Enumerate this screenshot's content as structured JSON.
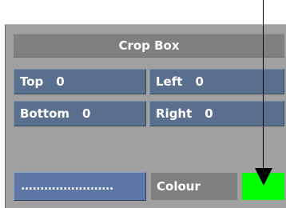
{
  "crop_box": {
    "title": "Crop Box",
    "top": {
      "label": "Top",
      "value": "0"
    },
    "left": {
      "label": "Left",
      "value": "0"
    },
    "bottom": {
      "label": "Bottom",
      "value": "0"
    },
    "right": {
      "label": "Right",
      "value": "0"
    }
  },
  "bottom_row": {
    "dots_button_label": "........................",
    "colour_label": "Colour",
    "colour_value": "#00ff00"
  },
  "callout": {
    "arrow_color": "#000000"
  }
}
